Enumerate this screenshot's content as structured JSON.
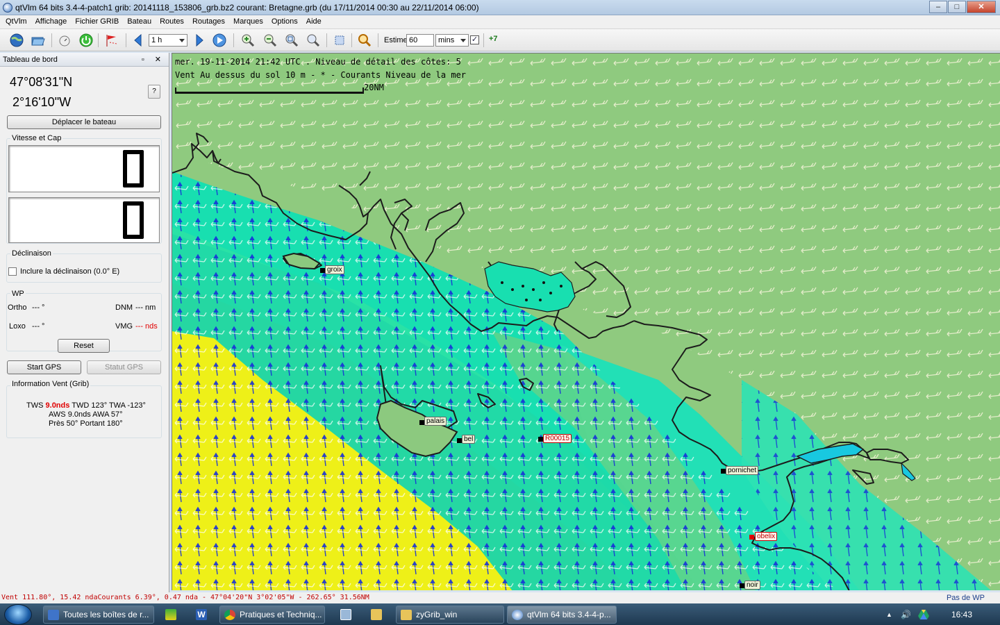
{
  "window": {
    "title": "qtVlm 64 bits 3.4-4-patch1 grib: 20141118_153806_grb.bz2 courant: Bretagne.grb (du 17/11/2014 00:30 au 22/11/2014 06:00)",
    "minimize": "–",
    "maximize": "□",
    "close": "✕"
  },
  "menu": [
    "QtVlm",
    "Affichage",
    "Fichier GRIB",
    "Bateau",
    "Routes",
    "Routages",
    "Marques",
    "Options",
    "Aide"
  ],
  "toolbar": {
    "step_value": "1 h",
    "estime_label": "Estime",
    "estime_value": "60",
    "estime_unit": "mins",
    "estime_checked": "✓",
    "extra_label": "+7"
  },
  "dashboard": {
    "title": "Tableau de bord",
    "title_buttons": "▫ ✕",
    "latitude": "47°08'31\"N",
    "longitude": "2°16'10\"W",
    "help_button": "?",
    "move_boat_button": "Déplacer le bateau",
    "speed_group_label": "Vitesse et Cap",
    "speed_value": "0",
    "heading_value": "0",
    "declination_group_label": "Déclinaison",
    "declination_checkbox_label": "Inclure la déclinaison (0.0° E)",
    "wp_group_label": "WP",
    "ortho_label": "Ortho",
    "ortho_value": "--- °",
    "loxo_label": "Loxo",
    "loxo_value": "--- °",
    "dnm_label": "DNM",
    "dnm_value": "--- nm",
    "vmg_label": "VMG",
    "vmg_value": "--- nds",
    "reset_button": "Reset",
    "start_gps_button": "Start GPS",
    "gps_status_button": "Statut GPS",
    "wind_group_label": "Information Vent (Grib)",
    "tws_label": "TWS",
    "tws_value": "9.0nds",
    "wind_line1_rest": "TWD 123° TWA -123°",
    "wind_line2": "AWS 9.0nds AWA 57°",
    "wind_line3": "Près 50° Portant 180°"
  },
  "map": {
    "info_line1": "mer. 19-11-2014 21:42 UTC . Niveau de détail des côtes: 5",
    "info_line2": "Vent Au dessus du sol 10 m - * - Courants Niveau de la mer",
    "scale_label": "20NM",
    "pois": [
      "groix",
      "palais",
      "bel",
      "R00015",
      "pornichet",
      "obelix",
      "noir"
    ]
  },
  "statusbar": {
    "left": "Vent 111.80°,  15.42 ndaCourants   6.39°,   0.47 nda -  47°04'20\"N  3°02'05\"W - 262.65°   31.56NM",
    "right": "Pas de WP"
  },
  "taskbar": {
    "tasks": [
      "Toutes les boîtes de r...",
      "Pratiques et Techniq...",
      "zyGrib_win",
      "qtVlm 64 bits 3.4-4-p..."
    ],
    "clock": "16:43",
    "tray_arrow": "▲",
    "tray_volume": "🔊"
  }
}
